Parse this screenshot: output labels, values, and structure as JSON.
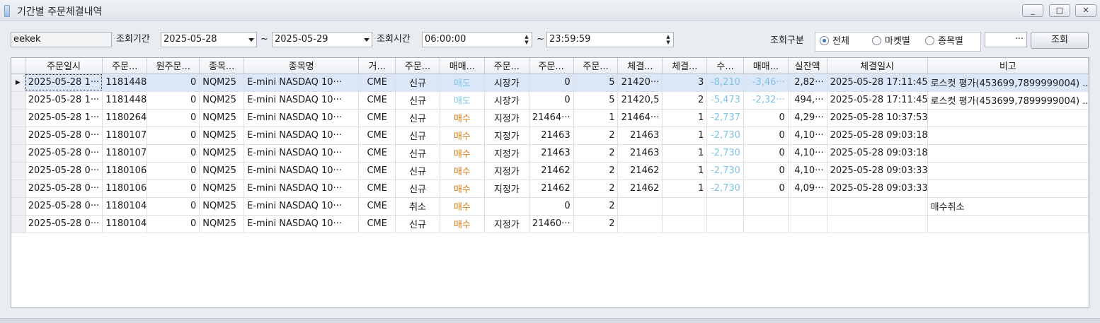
{
  "window": {
    "title": "기간별 주문체결내역",
    "minimize": "_",
    "maximize": "□",
    "close": "✕"
  },
  "filter": {
    "account_value": "eekek",
    "period_label": "조회기간",
    "date_from": "2025-05-28",
    "tilde1": "~",
    "date_to": "2025-05-29",
    "time_label": "조회시간",
    "time_from": "06:00:00",
    "tilde2": "~",
    "time_to": "23:59:59",
    "type_label": "조회구분",
    "radio_all": "전체",
    "radio_market": "마켓별",
    "radio_item": "종목별",
    "more_button": "···",
    "search_button": "조회"
  },
  "grid": {
    "columns": [
      "주문일시",
      "주문...",
      "원주문...",
      "종목...",
      "종목명",
      "거...",
      "주문...",
      "매매...",
      "주문...",
      "주문...",
      "주문...",
      "체결...",
      "체결...",
      "수...",
      "매매...",
      "실잔액",
      "체결일시",
      "비고"
    ],
    "rows": [
      {
        "order_time": "2025-05-28 1···",
        "order_no": "1181448",
        "orig_no": "0",
        "code": "NQM25",
        "name": "E-mini NASDAQ 10···",
        "exch": "CME",
        "kind": "신규",
        "side": "매도",
        "otype": "시장가",
        "oprice": "0",
        "oqty": "5",
        "fprice": "21420···",
        "fqty": "3",
        "fee": "-8,210",
        "pnl": "-3,46···",
        "bal": "2,82···",
        "fill_time": "2025-05-28 17:11:45",
        "note": "로스컷 평가(453699,7899999004) ..."
      },
      {
        "order_time": "2025-05-28 1···",
        "order_no": "1181448",
        "orig_no": "0",
        "code": "NQM25",
        "name": "E-mini NASDAQ 10···",
        "exch": "CME",
        "kind": "신규",
        "side": "매도",
        "otype": "시장가",
        "oprice": "0",
        "oqty": "5",
        "fprice": "21420,5",
        "fqty": "2",
        "fee": "-5,473",
        "pnl": "-2,32···",
        "bal": "494,···",
        "fill_time": "2025-05-28 17:11:45",
        "note": "로스컷 평가(453699,7899999004) ..."
      },
      {
        "order_time": "2025-05-28 1···",
        "order_no": "1180264",
        "orig_no": "0",
        "code": "NQM25",
        "name": "E-mini NASDAQ 10···",
        "exch": "CME",
        "kind": "신규",
        "side": "매수",
        "otype": "지정가",
        "oprice": "21464···",
        "oqty": "1",
        "fprice": "21464···",
        "fqty": "1",
        "fee": "-2,737",
        "pnl": "0",
        "bal": "4,29···",
        "fill_time": "2025-05-28 10:37:53",
        "note": ""
      },
      {
        "order_time": "2025-05-28 0···",
        "order_no": "1180107",
        "orig_no": "0",
        "code": "NQM25",
        "name": "E-mini NASDAQ 10···",
        "exch": "CME",
        "kind": "신규",
        "side": "매수",
        "otype": "지정가",
        "oprice": "21463",
        "oqty": "2",
        "fprice": "21463",
        "fqty": "1",
        "fee": "-2,730",
        "pnl": "0",
        "bal": "4,10···",
        "fill_time": "2025-05-28 09:03:18",
        "note": ""
      },
      {
        "order_time": "2025-05-28 0···",
        "order_no": "1180107",
        "orig_no": "0",
        "code": "NQM25",
        "name": "E-mini NASDAQ 10···",
        "exch": "CME",
        "kind": "신규",
        "side": "매수",
        "otype": "지정가",
        "oprice": "21463",
        "oqty": "2",
        "fprice": "21463",
        "fqty": "1",
        "fee": "-2,730",
        "pnl": "0",
        "bal": "4,10···",
        "fill_time": "2025-05-28 09:03:18",
        "note": ""
      },
      {
        "order_time": "2025-05-28 0···",
        "order_no": "1180106",
        "orig_no": "0",
        "code": "NQM25",
        "name": "E-mini NASDAQ 10···",
        "exch": "CME",
        "kind": "신규",
        "side": "매수",
        "otype": "지정가",
        "oprice": "21462",
        "oqty": "2",
        "fprice": "21462",
        "fqty": "1",
        "fee": "-2,730",
        "pnl": "0",
        "bal": "4,10···",
        "fill_time": "2025-05-28 09:03:33",
        "note": ""
      },
      {
        "order_time": "2025-05-28 0···",
        "order_no": "1180106",
        "orig_no": "0",
        "code": "NQM25",
        "name": "E-mini NASDAQ 10···",
        "exch": "CME",
        "kind": "신규",
        "side": "매수",
        "otype": "지정가",
        "oprice": "21462",
        "oqty": "2",
        "fprice": "21462",
        "fqty": "1",
        "fee": "-2,730",
        "pnl": "0",
        "bal": "4,09···",
        "fill_time": "2025-05-28 09:03:33",
        "note": ""
      },
      {
        "order_time": "2025-05-28 0···",
        "order_no": "1180104",
        "orig_no": "0",
        "code": "NQM25",
        "name": "E-mini NASDAQ 10···",
        "exch": "CME",
        "kind": "취소",
        "side": "매수",
        "otype": "",
        "oprice": "0",
        "oqty": "2",
        "fprice": "",
        "fqty": "",
        "fee": "",
        "pnl": "",
        "bal": "",
        "fill_time": "",
        "note": "매수취소"
      },
      {
        "order_time": "2025-05-28 0···",
        "order_no": "1180104",
        "orig_no": "0",
        "code": "NQM25",
        "name": "E-mini NASDAQ 10···",
        "exch": "CME",
        "kind": "신규",
        "side": "매수",
        "otype": "지정가",
        "oprice": "21460···",
        "oqty": "2",
        "fprice": "",
        "fqty": "",
        "fee": "",
        "pnl": "",
        "bal": "",
        "fill_time": "",
        "note": ""
      }
    ]
  },
  "colors": {
    "sell": "#7fc3e6",
    "buy": "#e07a10",
    "negative": "#7fc3e6",
    "selected_row": "#dbe6f7"
  }
}
